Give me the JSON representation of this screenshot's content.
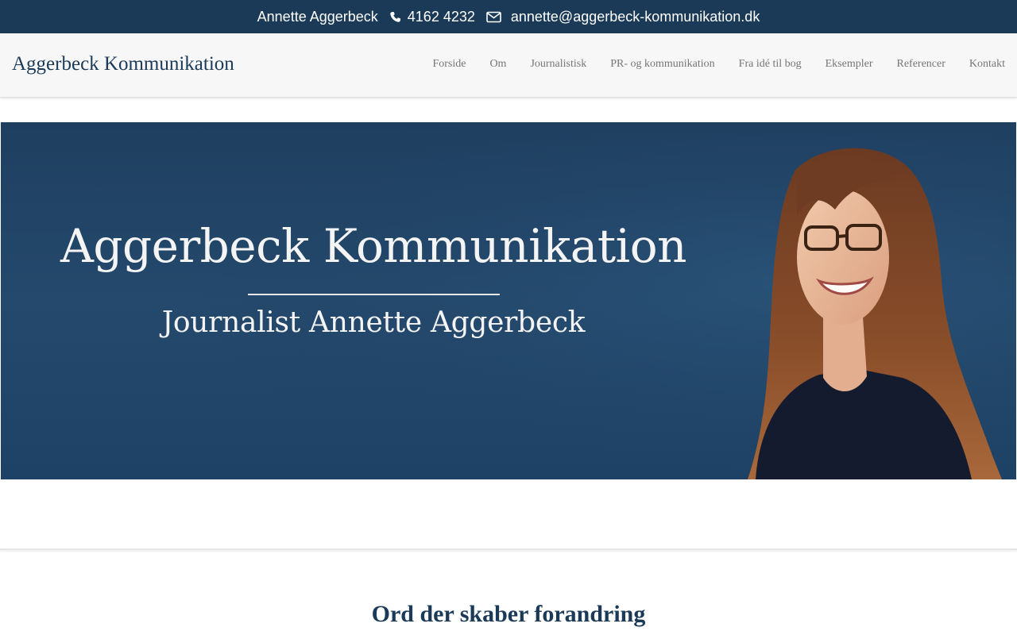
{
  "topbar": {
    "name": "Annette Aggerbeck",
    "phone": "4162 4232",
    "email": "annette@aggerbeck-kommunikation.dk",
    "phone_icon": "phone-icon",
    "email_icon": "envelope-icon"
  },
  "header": {
    "logo": "Aggerbeck Kommunikation",
    "nav": [
      {
        "label": "Forside"
      },
      {
        "label": "Om"
      },
      {
        "label": "Journalistisk"
      },
      {
        "label": "PR- og kommunikation"
      },
      {
        "label": "Fra idé til bog"
      },
      {
        "label": "Eksempler"
      },
      {
        "label": "Referencer"
      },
      {
        "label": "Kontakt"
      }
    ]
  },
  "hero": {
    "title": "Aggerbeck Kommunikation",
    "subtitle": "Journalist Annette Aggerbeck",
    "image": "portrait-photo"
  },
  "main": {
    "heading": "Ord der skaber forandring"
  },
  "colors": {
    "brand_navy": "#1b3a57",
    "nav_text": "#757575",
    "banner_blue": "#24496c"
  }
}
